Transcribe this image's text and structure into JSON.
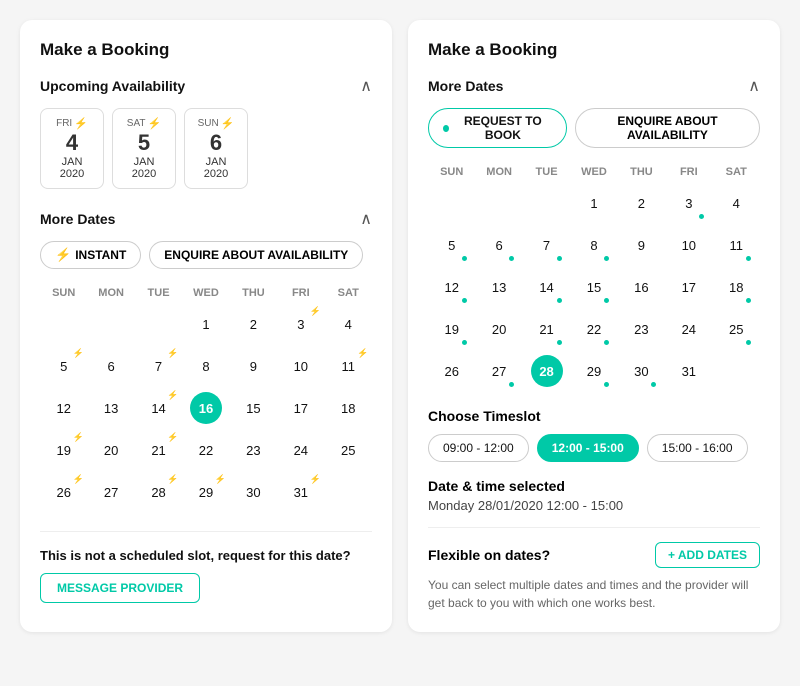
{
  "left_panel": {
    "title": "Make a Booking",
    "upcoming_section": {
      "label": "Upcoming Availability",
      "cards": [
        {
          "day_abbr": "FRI",
          "has_bolt": true,
          "day_num": "4",
          "month_abbr": "JAN",
          "year": "2020"
        },
        {
          "day_abbr": "SAT",
          "has_bolt": true,
          "day_num": "5",
          "month_abbr": "JAN",
          "year": "2020"
        },
        {
          "day_abbr": "SUN",
          "has_bolt": true,
          "day_num": "6",
          "month_abbr": "JAN",
          "year": "2020"
        }
      ]
    },
    "more_dates_section": {
      "label": "More Dates",
      "btn_instant": "INSTANT",
      "btn_enquire": "ENQUIRE ABOUT AVAILABILITY"
    },
    "calendar": {
      "headers": [
        "SUN",
        "MON",
        "TUE",
        "WED",
        "THU",
        "FRI",
        "SAT"
      ],
      "weeks": [
        [
          "",
          "",
          "",
          "1",
          "2",
          "3",
          "4",
          "5"
        ],
        [
          "6",
          "7",
          "8",
          "9",
          "10",
          "11",
          "12"
        ],
        [
          "13",
          "14",
          "15",
          "16",
          "17",
          "18",
          "19"
        ],
        [
          "20",
          "21",
          "22",
          "23",
          "24",
          "25",
          "26"
        ],
        [
          "27",
          "28",
          "29",
          "30",
          "31",
          "",
          ""
        ]
      ],
      "bolt_days": [
        "7",
        "11",
        "14",
        "21",
        "28",
        "3",
        "19",
        "26",
        "29"
      ],
      "selected_day": "16"
    },
    "not_scheduled": {
      "text": "This is not a scheduled slot, request for this date?",
      "btn_label": "MESSAGE PROVIDER"
    }
  },
  "right_panel": {
    "title": "Make a Booking",
    "more_dates_section": {
      "label": "More Dates",
      "btn_request": "REQUEST TO BOOK",
      "btn_enquire": "ENQUIRE ABOUT AVAILABILITY"
    },
    "calendar": {
      "headers": [
        "SUN",
        "MON",
        "TUE",
        "WED",
        "THU",
        "FRI",
        "SAT"
      ],
      "weeks": [
        [
          "",
          "",
          "",
          "1",
          "2",
          "3",
          "4",
          "5"
        ],
        [
          "6",
          "7",
          "8",
          "9",
          "10",
          "11",
          "12"
        ],
        [
          "13",
          "14",
          "15",
          "16",
          "17",
          "18",
          "19"
        ],
        [
          "20",
          "21",
          "22",
          "23",
          "24",
          "25",
          "26"
        ],
        [
          "27",
          "28",
          "29",
          "30",
          "31",
          "",
          ""
        ]
      ],
      "dot_days": [
        "6",
        "7",
        "8",
        "11",
        "14",
        "15",
        "18",
        "19",
        "21",
        "22",
        "25",
        "27",
        "28",
        "29"
      ],
      "selected_day": "28"
    },
    "timeslot_section": {
      "title": "Choose Timeslot",
      "slots": [
        "09:00 - 12:00",
        "12:00 - 15:00",
        "15:00 - 16:00"
      ],
      "active_slot": "12:00 - 15:00"
    },
    "datetime_section": {
      "title": "Date & time selected",
      "value": "Monday 28/01/2020 12:00 - 15:00"
    },
    "flexible_section": {
      "title": "Flexible on dates?",
      "btn_add_dates": "+ ADD DATES",
      "description": "You can select multiple dates and times and the provider will get back to you with which one works best."
    }
  },
  "icons": {
    "bolt": "⚡",
    "chevron_up": "∧",
    "plus": "+"
  },
  "colors": {
    "teal": "#00c9a7",
    "border": "#ddd",
    "text_dark": "#111",
    "text_muted": "#666"
  }
}
